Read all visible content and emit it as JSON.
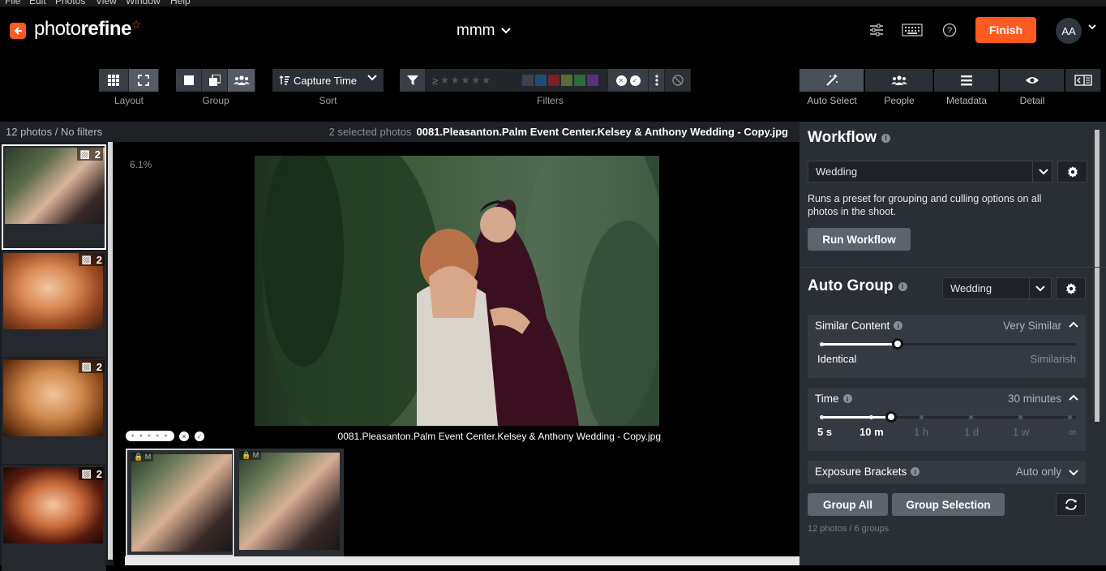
{
  "menu": [
    "File",
    "Edit",
    "Photos",
    "View",
    "Window",
    "Help"
  ],
  "app": {
    "logo_light": "photo",
    "logo_bold": "refine",
    "project": "mmm",
    "finish": "Finish",
    "avatar": "AA"
  },
  "toolbar": {
    "layout_label": "Layout",
    "group_label": "Group",
    "sort_value": "Capture Time",
    "sort_label": "Sort",
    "filters_label": "Filters",
    "rating_prefix": "≥",
    "color_labels": [
      "#3b4150",
      "#1f4d7a",
      "#7a1f2a",
      "#5a6a3a",
      "#2f6a3a",
      "#5a2f7a"
    ],
    "right_tabs": [
      "Auto Select",
      "People",
      "Metadata",
      "Detail"
    ]
  },
  "status": {
    "count": "12 photos / No filters",
    "selected": "2 selected photos",
    "filename": "0081.Pleasanton.Palm Event Center.Kelsey & Anthony Wedding - Copy.jpg"
  },
  "filmstrip": [
    {
      "count": "2"
    },
    {
      "count": "2"
    },
    {
      "count": "2"
    },
    {
      "count": "2"
    }
  ],
  "viewer": {
    "zoom": "6.1%",
    "caption": "0081.Pleasanton.Palm Event Center.Kelsey & Anthony Wedding - Copy.jpg",
    "thumb_tag": "M"
  },
  "panel": {
    "workflow": {
      "title": "Workflow",
      "preset": "Wedding",
      "desc": "Runs a preset for grouping and culling options on all photos in the shoot.",
      "run": "Run Workflow"
    },
    "auto_group": {
      "title": "Auto Group",
      "preset": "Wedding",
      "similar": {
        "label": "Similar Content",
        "value": "Very Similar",
        "min": "Identical",
        "max": "Similarish",
        "level": 0.3
      },
      "time": {
        "label": "Time",
        "value": "30 minutes",
        "ticks": [
          "5 s",
          "10 m",
          "1 h",
          "1 d",
          "1 w",
          "∞"
        ]
      },
      "brackets": {
        "label": "Exposure Brackets",
        "value": "Auto only"
      },
      "group_all": "Group All",
      "group_selection": "Group Selection",
      "summary": "12 photos / 6 groups"
    }
  }
}
